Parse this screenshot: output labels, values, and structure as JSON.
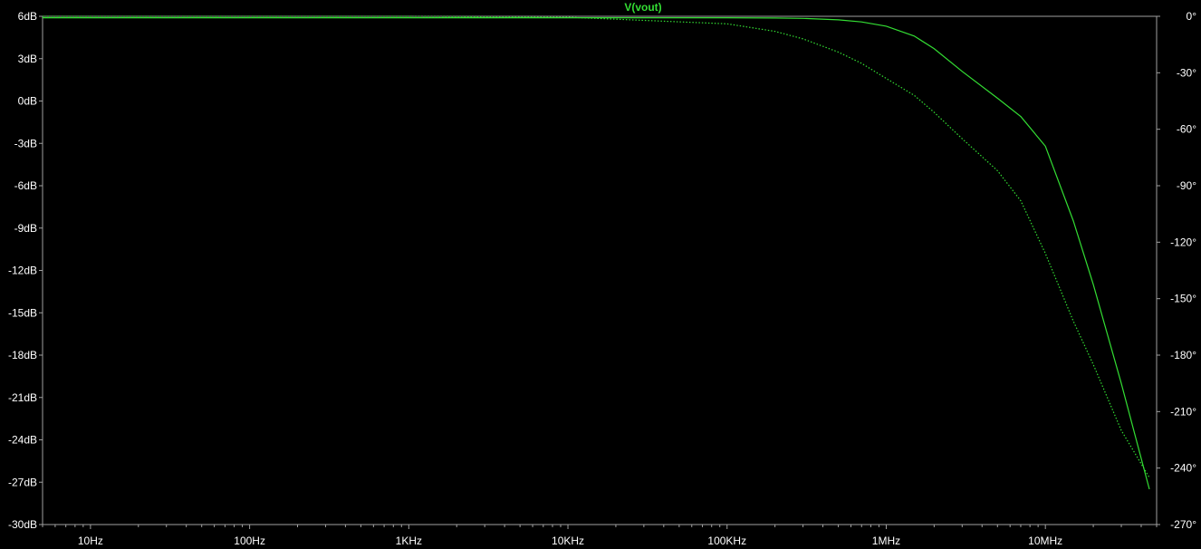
{
  "chart_data": {
    "type": "line",
    "title": "V(vout)",
    "xlabel": "",
    "ylabel": "",
    "x_scale": "log",
    "xlim": [
      5,
      50000000
    ],
    "ylim": [
      -30,
      6
    ],
    "y2lim": [
      -270,
      0
    ],
    "x_ticks": [
      {
        "value": 10,
        "label": "10Hz"
      },
      {
        "value": 100,
        "label": "100Hz"
      },
      {
        "value": 1000,
        "label": "1KHz"
      },
      {
        "value": 10000,
        "label": "10KHz"
      },
      {
        "value": 100000,
        "label": "100KHz"
      },
      {
        "value": 1000000,
        "label": "1MHz"
      },
      {
        "value": 10000000,
        "label": "10MHz"
      }
    ],
    "y_ticks": [
      {
        "value": 6,
        "label": "6dB"
      },
      {
        "value": 3,
        "label": "3dB"
      },
      {
        "value": 0,
        "label": "0dB"
      },
      {
        "value": -3,
        "label": "-3dB"
      },
      {
        "value": -6,
        "label": "-6dB"
      },
      {
        "value": -9,
        "label": "-9dB"
      },
      {
        "value": -12,
        "label": "-12dB"
      },
      {
        "value": -15,
        "label": "-15dB"
      },
      {
        "value": -18,
        "label": "-18dB"
      },
      {
        "value": -21,
        "label": "-21dB"
      },
      {
        "value": -24,
        "label": "-24dB"
      },
      {
        "value": -27,
        "label": "-27dB"
      },
      {
        "value": -30,
        "label": "-30dB"
      }
    ],
    "y2_ticks": [
      {
        "value": 0,
        "label": "0°"
      },
      {
        "value": -30,
        "label": "-30°"
      },
      {
        "value": -60,
        "label": "-60°"
      },
      {
        "value": -90,
        "label": "-90°"
      },
      {
        "value": -120,
        "label": "-120°"
      },
      {
        "value": -150,
        "label": "-150°"
      },
      {
        "value": -180,
        "label": "-180°"
      },
      {
        "value": -210,
        "label": "-210°"
      },
      {
        "value": -240,
        "label": "-240°"
      },
      {
        "value": -270,
        "label": "-270°"
      }
    ],
    "series": [
      {
        "name": "V(vout)",
        "quantity": "magnitude (dB)",
        "axis": "left",
        "line_style": "solid",
        "x": [
          5,
          10,
          100,
          1000,
          10000,
          100000,
          200000,
          300000,
          500000,
          700000,
          1000000,
          1500000,
          2000000,
          3000000,
          5000000,
          7000000,
          10000000,
          15000000,
          20000000,
          30000000,
          45000000
        ],
        "y": [
          5.9,
          5.9,
          5.9,
          5.9,
          5.9,
          5.9,
          5.88,
          5.85,
          5.75,
          5.6,
          5.3,
          4.6,
          3.7,
          2.1,
          0.2,
          -1.1,
          -3.2,
          -8.5,
          -13.0,
          -20.0,
          -27.5
        ]
      },
      {
        "name": "V(vout)",
        "quantity": "phase (°)",
        "axis": "right",
        "line_style": "dotted",
        "x": [
          5,
          10,
          100,
          1000,
          10000,
          100000,
          200000,
          300000,
          500000,
          700000,
          1000000,
          1500000,
          2000000,
          3000000,
          5000000,
          7000000,
          10000000,
          15000000,
          20000000,
          30000000,
          45000000
        ],
        "y": [
          0,
          0,
          0,
          0,
          -0.5,
          -4,
          -8,
          -12,
          -19,
          -25,
          -33,
          -42,
          -51,
          -65,
          -82,
          -98,
          -126,
          -162,
          -185,
          -220,
          -245
        ]
      }
    ]
  },
  "colors": {
    "background": "#000000",
    "axis": "#a0a0a0",
    "tick_label": "#ffffff",
    "trace": "#33dd33",
    "title": "#33dd33"
  }
}
